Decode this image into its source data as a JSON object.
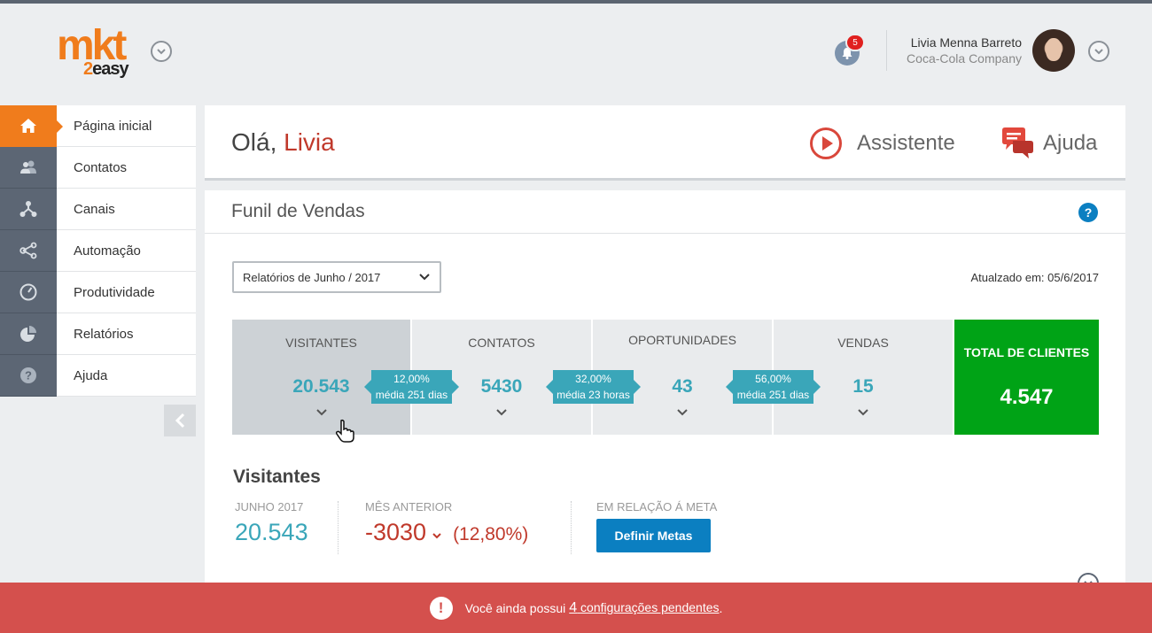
{
  "header": {
    "logo_text": "mkt",
    "logo_sub_num": "2",
    "logo_sub_word": "easy",
    "notifications_count": "5",
    "user_name": "Livia Menna Barreto",
    "user_company": "Coca-Cola Company"
  },
  "sidebar": {
    "items": [
      {
        "label": "Página inicial",
        "icon": "home-icon"
      },
      {
        "label": "Contatos",
        "icon": "users-icon"
      },
      {
        "label": "Canais",
        "icon": "channels-icon"
      },
      {
        "label": "Automação",
        "icon": "automation-icon"
      },
      {
        "label": "Produtividade",
        "icon": "gauge-icon"
      },
      {
        "label": "Relatórios",
        "icon": "pie-chart-icon"
      },
      {
        "label": "Ajuda",
        "icon": "question-icon"
      }
    ]
  },
  "greeting": {
    "prefix": "Olá,",
    "name": "Livia",
    "assistant_label": "Assistente",
    "help_label": "Ajuda"
  },
  "funnel": {
    "title": "Funil de Vendas",
    "report_select": "Relatórios de Junho / 2017",
    "updated": "Atualzado em: 05/6/2017",
    "stages": [
      {
        "name": "VISITANTES",
        "value": "20.543"
      },
      {
        "name": "CONTATOS",
        "value": "5430"
      },
      {
        "name": "OPORTUNIDADES",
        "value": "43"
      },
      {
        "name": "VENDAS",
        "value": "15"
      }
    ],
    "conversions": [
      {
        "rate": "12,00%",
        "avg": "média 251 dias"
      },
      {
        "rate": "32,00%",
        "avg": "média 23 horas"
      },
      {
        "rate": "56,00%",
        "avg": "média 251 dias"
      }
    ],
    "total_label": "TOTAL DE CLIENTES",
    "total_value": "4.547"
  },
  "visitors": {
    "title": "Visitantes",
    "current_label": "JUNHO 2017",
    "current_value": "20.543",
    "previous_label": "MÊS ANTERIOR",
    "previous_value": "-3030",
    "previous_pct": "(12,80%)",
    "goal_label": "EM RELAÇÃO Á META",
    "goal_button": "Definir Metas"
  },
  "alert": {
    "text": "Você ainda possui",
    "count": "4",
    "link_text": "configurações pendentes",
    "suffix": "."
  },
  "colors": {
    "brand_orange": "#f07c1c",
    "accent_teal": "#3aa6b9",
    "success_green": "#00a316",
    "alert_red": "#d4504d",
    "primary_blue": "#0b7fc1"
  }
}
